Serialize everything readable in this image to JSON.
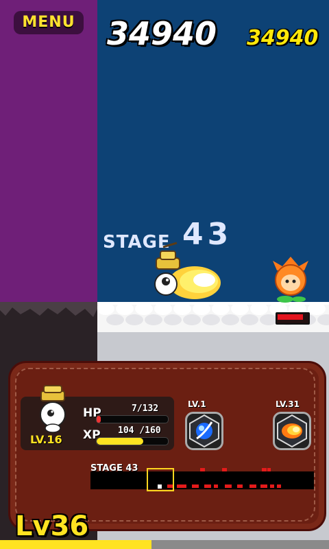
{
  "hud": {
    "menu_label": "MENU",
    "score": "34940",
    "high_score": "34940",
    "stage_word": "STAGE",
    "stage_number": "43"
  },
  "player_panel": {
    "hp_label": "HP",
    "hp_value": "7/132",
    "hp_ratio": 0.053,
    "xp_label": "XP",
    "xp_value": "104 /160",
    "xp_ratio": 0.65,
    "character_level": "LV.16"
  },
  "skills": [
    {
      "level_label": "LV.1",
      "icon": "blue-orb-icon"
    },
    {
      "level_label": "LV.31",
      "icon": "fireball-icon"
    }
  ],
  "stage_progress": {
    "label": "STAGE 43"
  },
  "player_level": "Lv36",
  "level_progress_ratio": 0.46,
  "enemy": {
    "hp_ratio": 0.92
  },
  "colors": {
    "accent_yellow": "#ffe321",
    "hp_red": "#e33333",
    "panel_brown": "#6b1f12",
    "sky_blue": "#0d4275",
    "left_purple": "#6f1f78"
  }
}
